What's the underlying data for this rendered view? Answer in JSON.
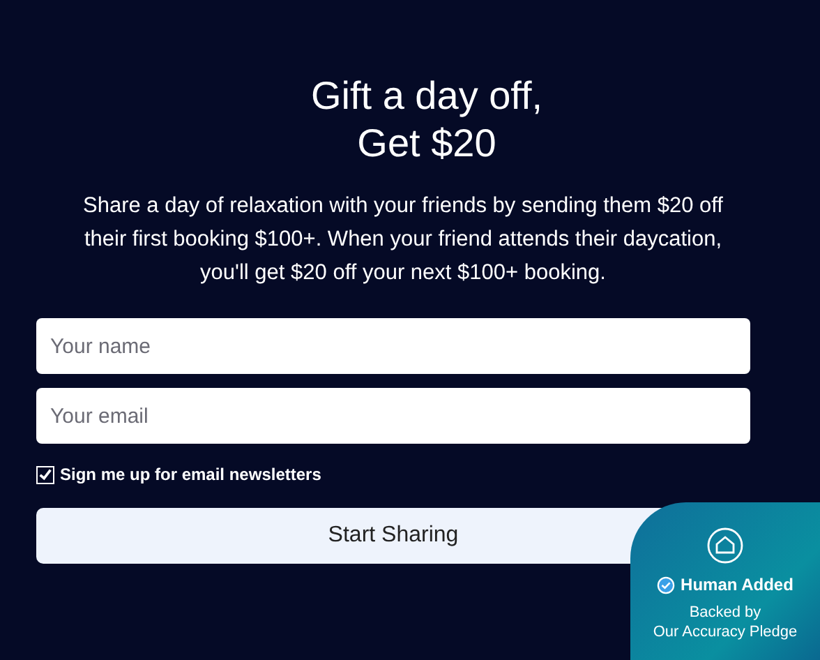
{
  "heading": [
    "Gift a day off,",
    "Get $20"
  ],
  "description": "Share a day of relaxation with your friends by sending them $20 off their first booking $100+. When your friend attends their daycation, you'll get $20 off your next $100+ booking.",
  "fields": [
    {
      "placeholder": "Your name"
    },
    {
      "placeholder": "Your email"
    }
  ],
  "newsletter": {
    "label": "Sign me up for email newsletters",
    "checked": true
  },
  "submit": "Start Sharing",
  "badge": {
    "title": "Human Added",
    "subtitle": [
      "Backed by",
      "Our Accuracy Pledge"
    ]
  }
}
